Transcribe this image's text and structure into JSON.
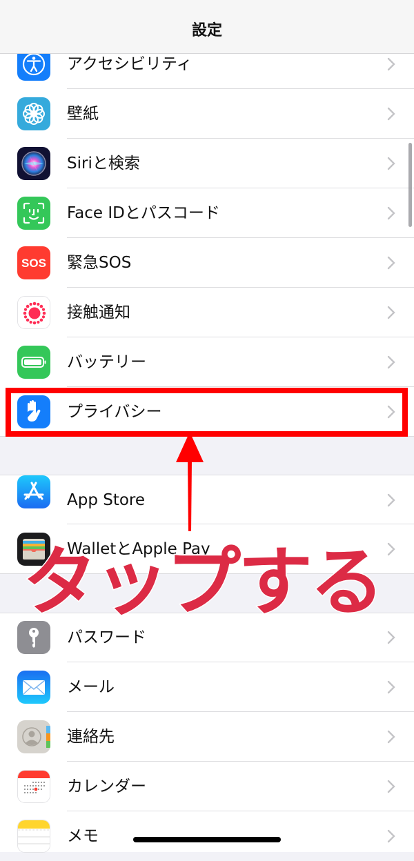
{
  "header": {
    "title": "設定"
  },
  "groups": [
    {
      "items": [
        {
          "label": "アクセシビリティ",
          "icon": "accessibility-icon",
          "icon_color": "#147efb"
        },
        {
          "label": "壁紙",
          "icon": "wallpaper-icon",
          "icon_color": "#35aadc"
        },
        {
          "label": "Siriと検索",
          "icon": "siri-icon",
          "icon_color": "#1c1c3a"
        },
        {
          "label": "Face IDとパスコード",
          "icon": "face-id-icon",
          "icon_color": "#34c759"
        },
        {
          "label": "緊急SOS",
          "icon": "sos-icon",
          "icon_color": "#ff3b30",
          "icon_text": "SOS"
        },
        {
          "label": "接触通知",
          "icon": "exposure-notification-icon",
          "icon_color": "#ff2d55"
        },
        {
          "label": "バッテリー",
          "icon": "battery-icon",
          "icon_color": "#34c759"
        },
        {
          "label": "プライバシー",
          "icon": "privacy-hand-icon",
          "icon_color": "#147efb"
        }
      ]
    },
    {
      "items": [
        {
          "label": "App Store",
          "icon": "app-store-icon",
          "icon_color": "#1c8cf5"
        },
        {
          "label": "WalletとApple Pay",
          "icon": "wallet-icon",
          "icon_color": "#1c1c1e"
        }
      ]
    },
    {
      "items": [
        {
          "label": "パスワード",
          "icon": "key-icon",
          "icon_color": "#8e8e93"
        },
        {
          "label": "メール",
          "icon": "mail-icon",
          "icon_color": "#1e8ff5"
        },
        {
          "label": "連絡先",
          "icon": "contacts-icon",
          "icon_color": "#d6d3cd"
        },
        {
          "label": "カレンダー",
          "icon": "calendar-icon",
          "icon_color": "#ffffff"
        },
        {
          "label": "メモ",
          "icon": "notes-icon",
          "icon_color": "#ffffff"
        }
      ]
    }
  ],
  "annotation": {
    "text": "タップする",
    "color": "#dc2b45",
    "highlight_color": "#ff0000",
    "target": "プライバシー"
  }
}
